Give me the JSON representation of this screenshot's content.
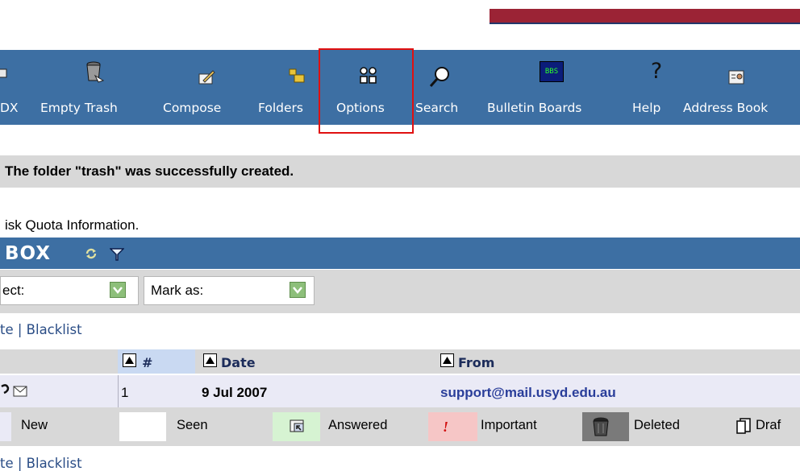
{
  "toolbar": {
    "items": [
      {
        "label": "DX",
        "icon": "inbox-icon"
      },
      {
        "label": "Empty Trash",
        "icon": "trash-icon"
      },
      {
        "label": "Compose",
        "icon": "compose-icon"
      },
      {
        "label": "Folders",
        "icon": "folder-icon"
      },
      {
        "label": "Options",
        "icon": "options-icon"
      },
      {
        "label": "Search",
        "icon": "search-icon"
      },
      {
        "label": "Bulletin Boards",
        "icon": "bbs-icon"
      },
      {
        "label": "Help",
        "icon": "help-icon"
      },
      {
        "label": "Address Book",
        "icon": "address-book-icon"
      }
    ],
    "bbs_icon_text": "BBS",
    "help_icon_text": "?"
  },
  "message": "The folder \"trash\" was successfully created.",
  "quota_link": "isk Quota Information.",
  "inbox": {
    "title": "BOX"
  },
  "controls": {
    "select_label": "ect:",
    "mark_as_label": "Mark as:"
  },
  "links_top": "te | Blacklist",
  "links_bottom": "te | Blacklist",
  "table": {
    "headers": {
      "num": "#",
      "date": "Date",
      "from": "From"
    },
    "rows": [
      {
        "num": "1",
        "date": "9 Jul 2007",
        "from": "support@mail.usyd.edu.au"
      }
    ]
  },
  "legend": {
    "new": "New",
    "seen": "Seen",
    "answered": "Answered",
    "important": "Important",
    "deleted": "Deleted",
    "drafts": "Draf"
  },
  "colors": {
    "toolbar_bg": "#3d6fa3",
    "highlight": "#e01010",
    "link": "#2a4d86",
    "header_strip": "#9b2335"
  }
}
